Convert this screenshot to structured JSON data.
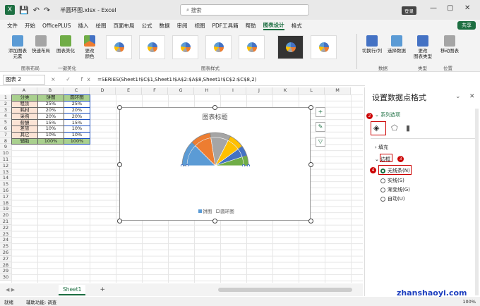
{
  "app": {
    "filename": "半圆环图.xlsx",
    "app_name": "Excel",
    "title_sep": "-",
    "search_placeholder": "搜索",
    "login": "登录",
    "share": "共享"
  },
  "menu": [
    "文件",
    "开始",
    "OfficePLUS",
    "插入",
    "绘图",
    "页面布局",
    "公式",
    "数据",
    "审阅",
    "视图",
    "PDF工具箱",
    "帮助",
    "图表设计",
    "格式"
  ],
  "active_menu": "图表设计",
  "ribbon": {
    "add_element": "添加图表\n元素",
    "quick_layout": "快速布局",
    "chart_beautify": "图表美化",
    "change_colors": "更改\n颜色",
    "switch_row_col": "切换行/列",
    "select_data": "选择数据",
    "change_type": "更改\n图表类型",
    "move_chart": "移动图表",
    "groups": [
      "图表布局",
      "一键美化",
      "图表样式",
      "数据",
      "类型",
      "位置"
    ]
  },
  "formula_bar": {
    "name_box": "图表 2",
    "icons": "× ✓ fx",
    "formula": "=SERIES(Sheet1!$C$1,Sheet1!$A$2:$A$8,Sheet1!$C$2:$C$8,2)"
  },
  "columns": [
    "A",
    "B",
    "C",
    "D",
    "E",
    "F",
    "G",
    "H",
    "I",
    "J",
    "K",
    "L",
    "M"
  ],
  "rows": [
    "1",
    "2",
    "3",
    "4",
    "5",
    "6",
    "7",
    "8",
    "9",
    "10",
    "11",
    "12",
    "13",
    "14",
    "15",
    "16",
    "17",
    "18",
    "19",
    "20",
    "21",
    "22",
    "23",
    "24",
    "25",
    "26",
    "27",
    "28",
    "29",
    "30"
  ],
  "table": {
    "headers": [
      "分类",
      "饼图",
      "圆环图"
    ],
    "rows": [
      [
        "租赁",
        "25%",
        "25%"
      ],
      [
        "耗材",
        "20%",
        "20%"
      ],
      [
        "采购",
        "20%",
        "20%"
      ],
      [
        "薪酬",
        "15%",
        "15%"
      ],
      [
        "差旅",
        "10%",
        "10%"
      ],
      [
        "其它",
        "10%",
        "10%"
      ],
      [
        "辅助",
        "100%",
        "100%"
      ]
    ]
  },
  "chart": {
    "title": "图表标题",
    "legend": [
      "饼图",
      "圆环图"
    ]
  },
  "chart_data": {
    "type": "pie",
    "title": "图表标题",
    "categories": [
      "租赁",
      "耗材",
      "采购",
      "薪酬",
      "差旅",
      "其它",
      "辅助"
    ],
    "series": [
      {
        "name": "饼图",
        "values": [
          25,
          20,
          20,
          15,
          10,
          10,
          100
        ]
      },
      {
        "name": "圆环图",
        "values": [
          25,
          20,
          20,
          15,
          10,
          10,
          100
        ]
      }
    ],
    "colors": [
      "#5b9bd5",
      "#ed7d31",
      "#a5a5a5",
      "#ffc000",
      "#4472c4",
      "#70ad47",
      "#ffffff"
    ],
    "legend_position": "bottom"
  },
  "sheet_tab": "Sheet1",
  "add_sheet": "+",
  "status": {
    "ready": "就绪",
    "accessibility": "辅助功能: 调查",
    "zoom": "100%"
  },
  "panel": {
    "title": "设置数据点格式",
    "series_options": "系列选项",
    "fill": "填充",
    "border": "边框",
    "options": [
      "无线条(N)",
      "实线(S)",
      "渐变线(G)",
      "自动(U)"
    ],
    "badges": [
      "2",
      "3",
      "4"
    ]
  },
  "watermark": "zhanshaoyi.com"
}
